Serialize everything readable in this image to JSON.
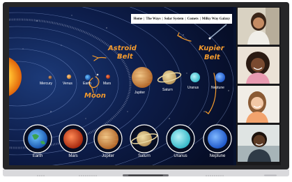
{
  "nav": {
    "home": "Home",
    "ways": "The Ways",
    "solar_system": "Solar System",
    "comets": "Comets",
    "milky_way": "Milky Way Galaxy"
  },
  "annotations": {
    "astroid_belt_1": "Astroid",
    "astroid_belt_2": "Belt",
    "kupier_belt_1": "Kupier",
    "kupier_belt_2": "Belt",
    "moon": "Moon",
    "accent_color": "#f39a2d"
  },
  "orbit_planets": [
    "Mercury",
    "Venus",
    "Earth",
    "Mars",
    "Jupiter",
    "Saturn",
    "Uranus",
    "Neptune"
  ],
  "planet_cards": [
    "Earth",
    "Mars",
    "Jupiter",
    "Saturn",
    "Uranus",
    "Neptune"
  ],
  "participants": [
    "participant-girl-1",
    "participant-girl-2",
    "participant-girl-3",
    "participant-boy"
  ]
}
